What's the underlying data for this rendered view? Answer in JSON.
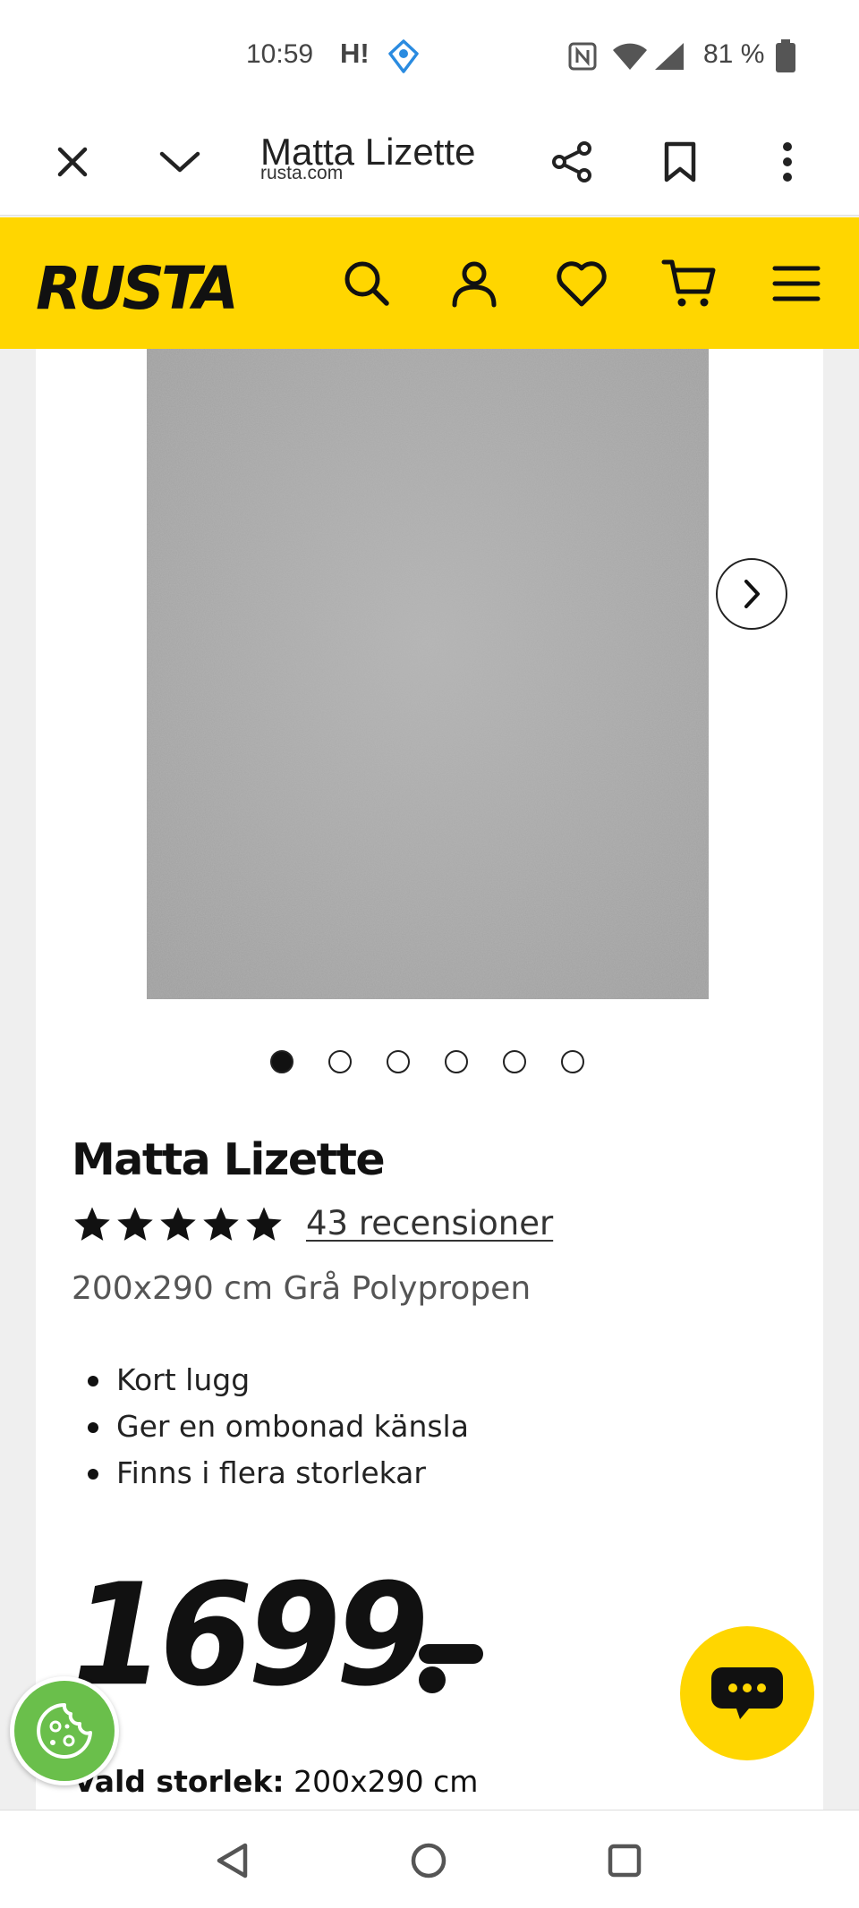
{
  "status_bar": {
    "time": "10:59",
    "carrier_label": "H!",
    "battery": "81 %"
  },
  "browser": {
    "page_title": "Matta Lizette",
    "url": "rusta.com",
    "icons": [
      "close-icon",
      "chevron-down-icon",
      "share-icon",
      "bookmark-icon",
      "more-vert-icon"
    ]
  },
  "header": {
    "logo_text": "RUSTA",
    "brand_color": "#ffd600",
    "icons": [
      "search-icon",
      "account-icon",
      "heart-icon",
      "cart-icon",
      "menu-icon"
    ]
  },
  "gallery": {
    "image_count": 6,
    "active_index": 0,
    "image_description_color": "#a8a8a8"
  },
  "product": {
    "title": "Matta Lizette",
    "rating": 5,
    "reviews": "43 recensioner",
    "variant": "200x290 cm Grå Polypropen",
    "features": [
      "Kort lugg",
      "Ger en ombonad känsla",
      "Finns i flera storlekar"
    ],
    "price": "1699",
    "selected_size_label": "Vald storlek:",
    "selected_size_value": "200x290 cm"
  },
  "floating": {
    "chat_icon": "chat-bubble-icon",
    "cookie_icon": "cookie-icon"
  },
  "nav": {
    "icons": [
      "back-icon",
      "home-icon",
      "recents-icon"
    ]
  }
}
